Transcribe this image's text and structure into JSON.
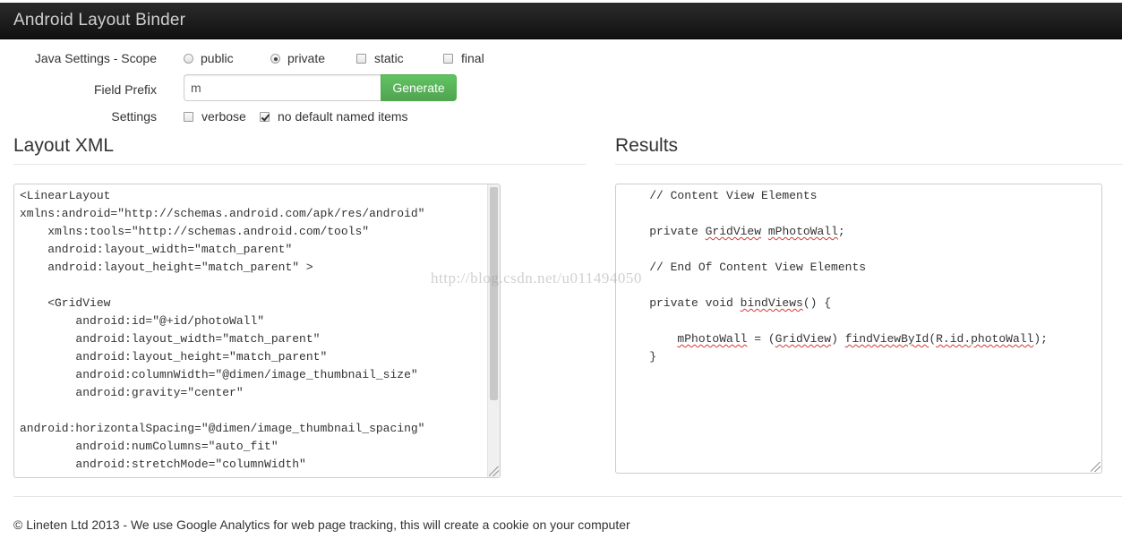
{
  "app": {
    "title": "Android Layout Binder"
  },
  "settings": {
    "scope_label": "Java Settings - Scope",
    "scope_options": [
      {
        "label": "public",
        "selected": false
      },
      {
        "label": "private",
        "selected": true
      }
    ],
    "modifiers": [
      {
        "label": "static",
        "checked": false
      },
      {
        "label": "final",
        "checked": false
      }
    ],
    "prefix_label": "Field Prefix",
    "prefix_value": "m",
    "generate_label": "Generate",
    "settings_label": "Settings",
    "flags": [
      {
        "label": "verbose",
        "checked": false
      },
      {
        "label": "no default named items",
        "checked": true
      }
    ]
  },
  "layout_xml": {
    "title": "Layout XML",
    "content": "<LinearLayout\nxmlns:android=\"http://schemas.android.com/apk/res/android\"\n    xmlns:tools=\"http://schemas.android.com/tools\"\n    android:layout_width=\"match_parent\"\n    android:layout_height=\"match_parent\" >\n\n    <GridView\n        android:id=\"@+id/photoWall\"\n        android:layout_width=\"match_parent\"\n        android:layout_height=\"match_parent\"\n        android:columnWidth=\"@dimen/image_thumbnail_size\"\n        android:gravity=\"center\"\n\nandroid:horizontalSpacing=\"@dimen/image_thumbnail_spacing\"\n        android:numColumns=\"auto_fit\"\n        android:stretchMode=\"columnWidth\""
  },
  "results": {
    "title": "Results",
    "lines": [
      {
        "segments": [
          {
            "t": "    // Content View Elements"
          }
        ]
      },
      {
        "segments": [
          {
            "t": ""
          }
        ]
      },
      {
        "segments": [
          {
            "t": "    private "
          },
          {
            "t": "GridView",
            "u": true
          },
          {
            "t": " "
          },
          {
            "t": "mPhotoWall",
            "u": true
          },
          {
            "t": ";"
          }
        ]
      },
      {
        "segments": [
          {
            "t": ""
          }
        ]
      },
      {
        "segments": [
          {
            "t": "    // End Of Content View Elements"
          }
        ]
      },
      {
        "segments": [
          {
            "t": ""
          }
        ]
      },
      {
        "segments": [
          {
            "t": "    private void "
          },
          {
            "t": "bindViews",
            "u": true
          },
          {
            "t": "() {"
          }
        ]
      },
      {
        "segments": [
          {
            "t": ""
          }
        ]
      },
      {
        "segments": [
          {
            "t": "        "
          },
          {
            "t": "mPhotoWall",
            "u": true
          },
          {
            "t": " = ("
          },
          {
            "t": "GridView",
            "u": true
          },
          {
            "t": ") "
          },
          {
            "t": "findViewById",
            "u": true
          },
          {
            "t": "("
          },
          {
            "t": "R.id.photoWall",
            "u": true
          },
          {
            "t": ");"
          }
        ]
      },
      {
        "segments": [
          {
            "t": "    }"
          }
        ]
      }
    ]
  },
  "watermark": "http://blog.csdn.net/u011494050",
  "footer": {
    "text": "© Lineten Ltd 2013 - We use Google Analytics for web page tracking, this will create a cookie on your computer"
  },
  "colors": {
    "accent_green": "#5bb75b",
    "topbar": "#1b1b1b"
  }
}
